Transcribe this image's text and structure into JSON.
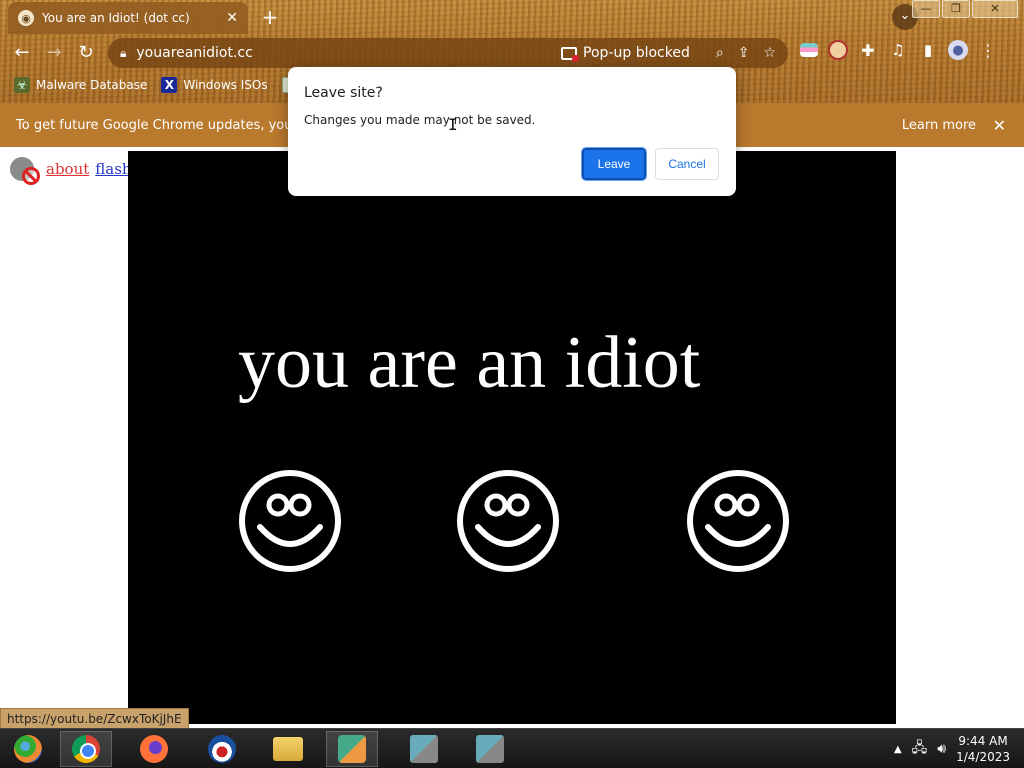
{
  "browser": {
    "tab_title": "You are an Idiot! (dot cc)",
    "tab_close": "✕",
    "new_tab": "+",
    "url": "youareanidiot.cc",
    "popup_blocked": "Pop-up blocked",
    "window_controls": [
      "—",
      "❐",
      "✕"
    ],
    "bookmarks": [
      {
        "label": "Malware Database",
        "icon": "malware-icon"
      },
      {
        "label": "Windows ISOs",
        "icon": "windows-x-icon"
      },
      {
        "label": "",
        "icon": "image-icon"
      }
    ],
    "infobar_message": "To get future Google Chrome updates, you'll nee",
    "infobar_learn_more": "Learn more",
    "infobar_close": "✕"
  },
  "dialog": {
    "title": "Leave site?",
    "text": "Changes you made may not be saved.",
    "leave_label": "Leave",
    "cancel_label": "Cancel"
  },
  "page": {
    "about_link": "about",
    "flash_link": "flash",
    "headline": "you are an idiot",
    "smiley_count": 3
  },
  "status_bar_url": "https://youtu.be/ZcwxToKjJhE",
  "taskbar": {
    "time": "9:44 AM",
    "date": "1/4/2023"
  },
  "colors": {
    "accent_blue": "#1a73e8",
    "stage_bg": "#000000",
    "infobar_bg": "#b97a2e"
  }
}
